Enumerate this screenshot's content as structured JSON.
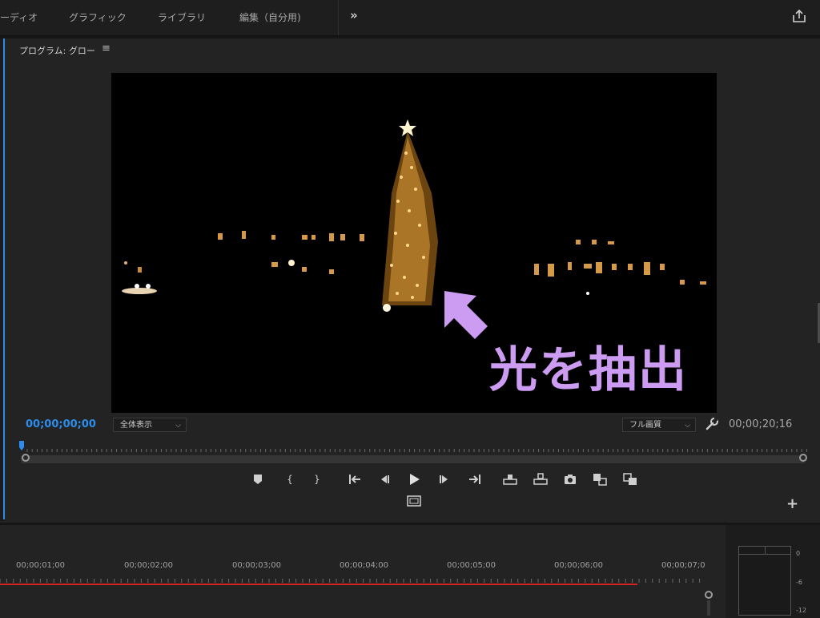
{
  "workspace_tabs": [
    "ーディオ",
    "グラフィック",
    "ライブラリ",
    "編集（自分用)"
  ],
  "icons": {
    "more": "double-chevron-right-icon",
    "share": "share-export-icon",
    "panel_menu": "hamburger-menu-icon",
    "settings": "wrench-icon",
    "add_button": "plus-icon"
  },
  "program_monitor": {
    "title": "プログラム: グロー",
    "overlay_text": "光を抽出",
    "overlay_color": "#cc9cf2",
    "timecode_current": "00;00;00;00",
    "timecode_duration": "00;00;20;16",
    "zoom_select": "全体表示",
    "quality_select": "フル画質"
  },
  "transport_controls": [
    "add-marker",
    "mark-in",
    "mark-out",
    "go-to-in",
    "step-back",
    "play",
    "step-forward",
    "go-to-out",
    "lift",
    "extract",
    "export-frame",
    "insert",
    "overwrite",
    "safe-margins"
  ],
  "timeline": {
    "ruler_labels": [
      "00;00;01;00",
      "00;00;02;00",
      "00;00;03;00",
      "00;00;04;00",
      "00;00;05;00",
      "00;00;06;00",
      "00;00;07;0"
    ]
  },
  "audio_meter": {
    "db_labels": [
      "0",
      "-6",
      "-12"
    ]
  },
  "colors": {
    "accent_blue": "#2d8ceb",
    "render_bar_red": "#d32424"
  }
}
